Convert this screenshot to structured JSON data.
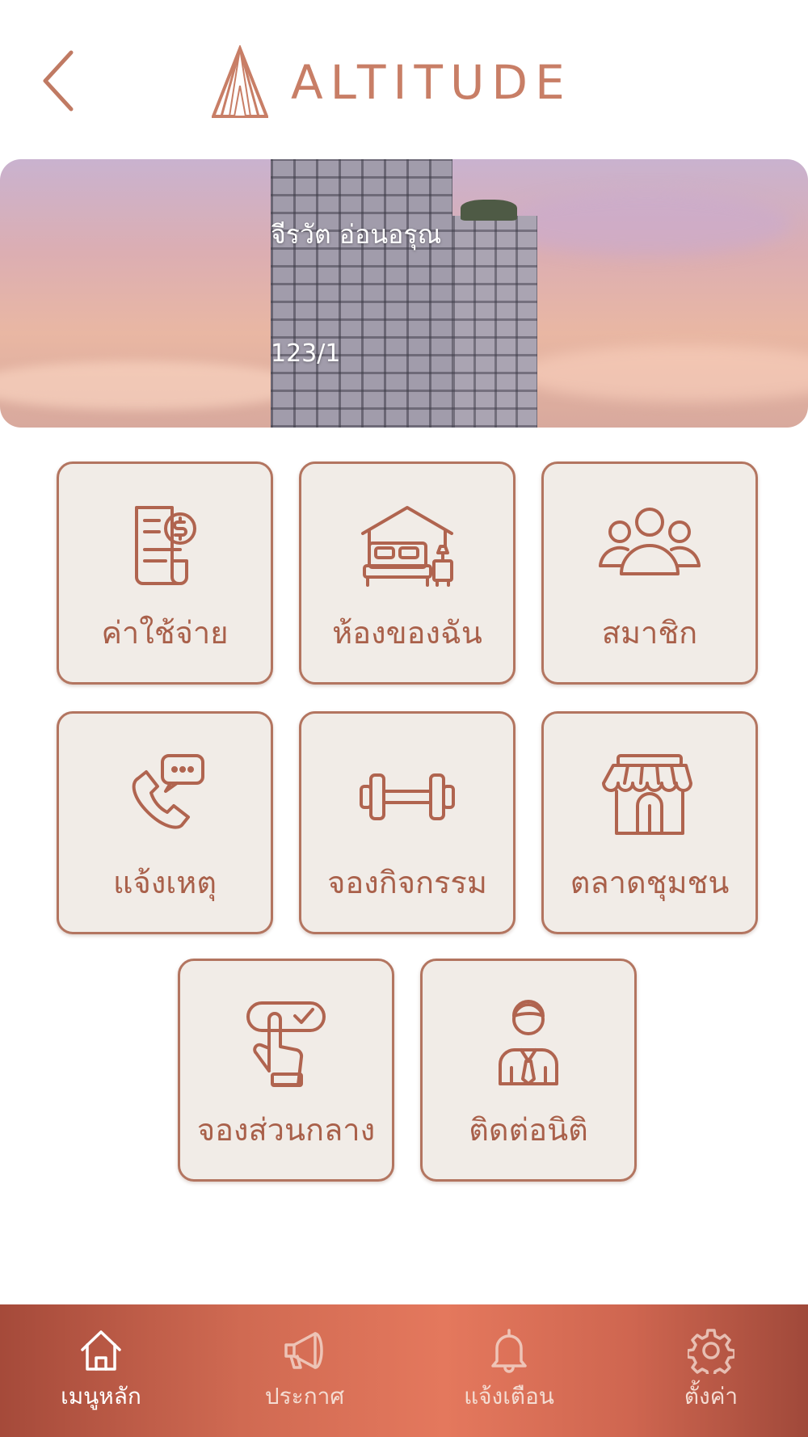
{
  "header": {
    "logo_text": "ALTITUDE",
    "back_icon": "chevron-left-icon"
  },
  "banner": {
    "resident_name": "จีรวัต อ่อนอรุณ",
    "unit_number": "123/1"
  },
  "menu": [
    {
      "label": "ค่าใช้จ่าย",
      "icon": "bill-icon"
    },
    {
      "label": "ห้องของฉัน",
      "icon": "bedroom-icon"
    },
    {
      "label": "สมาชิก",
      "icon": "members-icon"
    },
    {
      "label": "แจ้งเหตุ",
      "icon": "phone-chat-icon"
    },
    {
      "label": "จองกิจกรรม",
      "icon": "dumbbell-icon"
    },
    {
      "label": "ตลาดชุมชน",
      "icon": "shop-icon"
    },
    {
      "label": "จองส่วนกลาง",
      "icon": "tap-booking-icon"
    },
    {
      "label": "ติดต่อนิติ",
      "icon": "staff-icon"
    }
  ],
  "bottom_nav": [
    {
      "label": "เมนูหลัก",
      "icon": "home-icon",
      "active": true
    },
    {
      "label": "ประกาศ",
      "icon": "megaphone-icon",
      "active": false
    },
    {
      "label": "แจ้งเตือน",
      "icon": "bell-icon",
      "active": false
    },
    {
      "label": "ตั้งค่า",
      "icon": "gear-icon",
      "active": false
    }
  ],
  "colors": {
    "accent": "#b0644f",
    "tile_bg": "#f1ece7",
    "nav_gradient_center": "#e4785d"
  }
}
